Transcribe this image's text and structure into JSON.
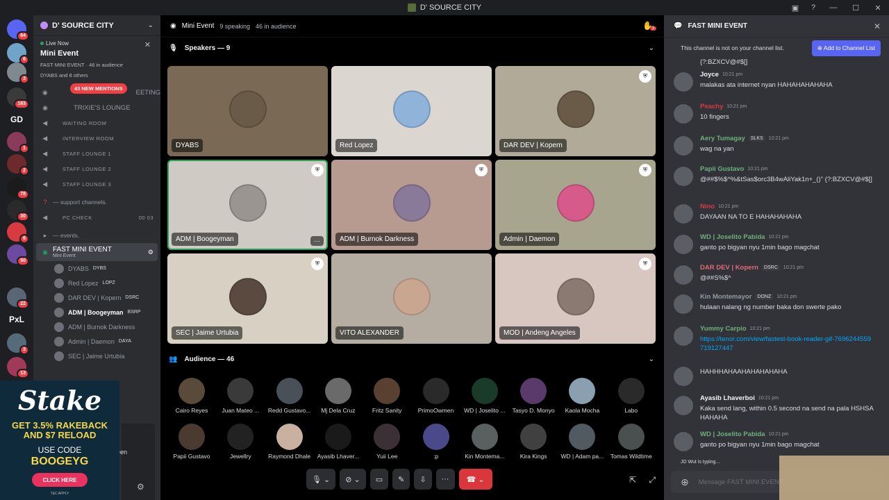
{
  "window": {
    "title": "D' SOURCE CITY"
  },
  "servers": [
    {
      "badge": "64"
    },
    {
      "badge": "6"
    },
    {
      "badge": "3"
    },
    {
      "badge": "163"
    },
    {
      "label": "GD"
    },
    {
      "badge": "1"
    },
    {
      "badge": "2"
    },
    {
      "badge": "78"
    },
    {
      "badge": "30"
    },
    {
      "badge": "6"
    },
    {
      "badge": "50"
    },
    {
      "badge": "22"
    },
    {
      "label": "PxL"
    },
    {
      "badge": "3"
    },
    {
      "badge": "13"
    }
  ],
  "sidebar": {
    "guild": "D' SOURCE CITY",
    "live": {
      "tag": "Live Now",
      "event": "Mini Event",
      "sub": "FAST MINI EVENT · 46 in audience",
      "who": "DYABS and 8 others"
    },
    "mentions": "43 NEW MENTIONS",
    "meeting_tail": "EETING",
    "channels": [
      "TRIXIE'S LOUNGE",
      "WAITING ROOM",
      "INTERVIEW ROOM",
      "STAFF LOUNGE 1",
      "STAFF LOUNGE 2",
      "STAFF LOUNGE 3"
    ],
    "support": "— support channels.",
    "pc": "PC CHECK",
    "pc_counts": "00  03",
    "events": "— events.",
    "active": {
      "name": "FAST MINI EVENT",
      "sub": "Mini Event"
    },
    "members": [
      {
        "name": "DYABS",
        "tag": "DYBS"
      },
      {
        "name": "Red Lopez",
        "tag": "LOPZ"
      },
      {
        "name": "DAR DEV | Kopern",
        "tag": "DSRC"
      },
      {
        "name": "ADM | Boogeyman",
        "tag": "BSRP"
      },
      {
        "name": "ADM | Burnok Darkness",
        "tag": ""
      },
      {
        "name": "Admin | Daemon",
        "tag": "DAYA"
      },
      {
        "name": "SEC | Jaime Urtubia",
        "tag": ""
      }
    ],
    "screen": "reen"
  },
  "ad": {
    "brand": "Stake",
    "line1": "GET 3.5% RAKEBACK",
    "line2": "AND $7 RELOAD",
    "line3": "USE CODE",
    "code": "BOOGEYG",
    "cta": "CLICK HERE",
    "tc": "T&C APPLY"
  },
  "stage": {
    "name": "Mini Event",
    "speaking": "9 speaking",
    "audience_count": "46 in audience",
    "hand_badge": "3",
    "speakers_head": "Speakers — 9",
    "audience_head": "Audience — 46",
    "speakers": [
      {
        "name": "DYABS",
        "color": "#7a6a55"
      },
      {
        "name": "Red Lopez",
        "color": "#dcd6d0"
      },
      {
        "name": "DAR DEV | Kopern",
        "color": "#b1aa98"
      },
      {
        "name": "ADM | Boogeyman",
        "color": "#cfcac4"
      },
      {
        "name": "ADM | Burnok Darkness",
        "color": "#b79a90"
      },
      {
        "name": "Admin | Daemon",
        "color": "#a8a58e"
      },
      {
        "name": "SEC | Jaime Urtubia",
        "color": "#d9d0c4"
      },
      {
        "name": "VITO ALEXANDER",
        "color": "#b6ada2"
      },
      {
        "name": "MOD | Andeng Angeles",
        "color": "#d8c6c0"
      }
    ],
    "audience": [
      "Cairo Reyes",
      "Juan Mateo ...",
      "Redd Gustavo...",
      "Mj Dela Cruz",
      "Fritz Sanity",
      "PrimoOwmen",
      "WD | Joselito ...",
      "Tasyo D. Monyo",
      "Kaola Mocha",
      "Labo",
      "Papii Gustavo",
      "Jewellry",
      "Raymond Dhale",
      "Ayasib Lhaver...",
      "Yuii Lee",
      ":p",
      "Kin Montema...",
      "Kira Kings",
      "WD | Adam pa...",
      "Tomas Wildtime"
    ]
  },
  "chat": {
    "title": "FAST MINI EVENT",
    "notice": "This channel is not on your channel list.",
    "add_button": "Add to Channel List",
    "top_fragment": "{?:BZXCV@#$[]",
    "messages": [
      {
        "user": "Joyce",
        "time": "10:21 pm",
        "text": "malakas ata internet nyan HAHAHAHAHAHA",
        "color": "#f2f3f5",
        "tag": ""
      },
      {
        "user": "Peachy",
        "time": "10:21 pm",
        "text": "10 fingers",
        "color": "#d83a42",
        "tag": ""
      },
      {
        "user": "Aery Tumagay",
        "time": "10:21 pm",
        "text": "wag na yan",
        "color": "#6fb07a",
        "tag": "SLKS"
      },
      {
        "user": "Papii Gustavo",
        "time": "10:21 pm",
        "text": "@##$%$^%&tSas$orc3B4wAliYak1n+_()\" {?:BZXCV@#$[]",
        "color": "#6fb07a",
        "tag": ""
      },
      {
        "user": "Nino",
        "time": "10:21 pm",
        "text": "DAYAAN NA TO E HAHAHAHAHA",
        "color": "#d83a42",
        "tag": ""
      },
      {
        "user": "WD | Joselito Pabida",
        "time": "10:21 pm",
        "text": "ganto po bigyan nyu 1min bago magchat",
        "color": "#6fb07a",
        "tag": ""
      },
      {
        "user": "DAR DEV | Kopern",
        "time": "10:21 pm",
        "text": "@##S%$^",
        "color": "#e06c75",
        "tag": "DSRC"
      },
      {
        "user": "Kin Montemayor",
        "time": "10:21 pm",
        "text": "hulaan nalang ng number baka don swerte pako",
        "color": "#949ba4",
        "tag": "DONZ"
      },
      {
        "user": "Yummy Carpio",
        "time": "10:21 pm",
        "text": "https://tenor.com/view/fastest-book-reader-gif-7696244559719127447",
        "color": "#6fb07a",
        "tag": "",
        "link": true
      },
      {
        "user": "",
        "time": "",
        "text": "HAHHHAHAAHAHAHAHAHA",
        "color": "#949ba4",
        "tag": ""
      },
      {
        "user": "Ayasib Lhaverboi",
        "time": "10:21 pm",
        "text": "Kaka send lang, within 0.5 second na send na pala HSHSAHAHAHA",
        "color": "#f2f3f5",
        "tag": ""
      },
      {
        "user": "WD | Joselito Pabida",
        "time": "10:21 pm",
        "text": "ganto po bigyan nyu 1min bago magchat",
        "color": "#6fb07a",
        "tag": ""
      }
    ],
    "typing": "JD Wut is typing...",
    "input_placeholder": "Message FAST MINI EVENT"
  }
}
